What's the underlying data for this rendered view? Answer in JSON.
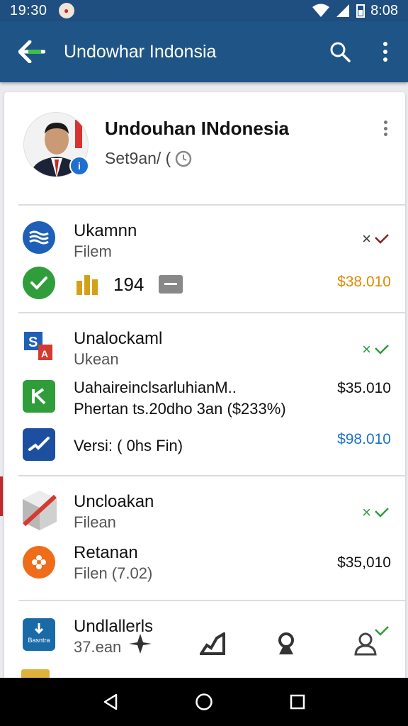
{
  "status_bar": {
    "time": "19:30",
    "right_time": "8:08"
  },
  "app_bar": {
    "title": "Undowhar Indonsia",
    "icons": [
      "back-arrow-icon",
      "search-icon",
      "more-vert-icon"
    ]
  },
  "profile": {
    "name": "Undouhan INdonesia",
    "subtitle": "Set9an/ ("
  },
  "items": [
    {
      "title": "Ukamnn",
      "subtitle": "Filem",
      "meta_value": "194",
      "price": "$38.010",
      "price_color": "#e08a00"
    },
    {
      "title": "Unalockaml",
      "subtitle": "Ukean"
    },
    {
      "title": "UahaireinclsarluhianM..",
      "subtitle": "Phertan ts.20dho 3an ($233%)",
      "price": "$35.010",
      "price_color": "#111111"
    },
    {
      "title": "Versi:  ( 0hs Fin)",
      "price": "$98.010",
      "price_color": "#1a73c9"
    },
    {
      "title": "Uncloakan",
      "subtitle": "Filean"
    },
    {
      "title": "Retanan",
      "subtitle": "Filen (7.02)",
      "price": "$35,010",
      "price_color": "#111111"
    },
    {
      "title": "Undlallerls",
      "subtitle": "37.ean"
    }
  ],
  "badge_text": "Basntra",
  "colors": {
    "app_bar": "#1f5486",
    "status_bar": "#1f4f80",
    "accent_green": "#2e9d3a"
  }
}
